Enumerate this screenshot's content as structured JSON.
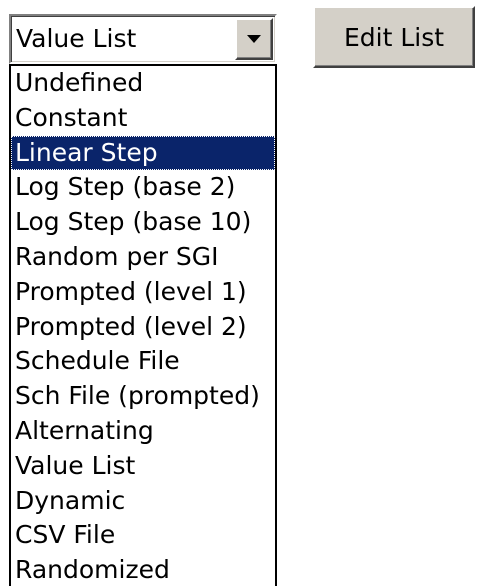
{
  "combo": {
    "value": "Value List",
    "arrow_icon": "chevron-down-icon"
  },
  "edit_button": {
    "label": "Edit List"
  },
  "dropdown": {
    "selected_index": 2,
    "options": [
      "Undefined",
      "Constant",
      "Linear Step",
      "Log Step (base 2)",
      "Log Step (base 10)",
      "Random per SGI",
      "Prompted (level 1)",
      "Prompted (level 2)",
      "Schedule File",
      "Sch File (prompted)",
      "Alternating",
      "Value List",
      "Dynamic",
      "CSV File",
      "Randomized"
    ]
  },
  "colors": {
    "face": "#d4d0c8",
    "highlight": "#0a246a",
    "highlight_text": "#ffffff",
    "text": "#000000"
  }
}
